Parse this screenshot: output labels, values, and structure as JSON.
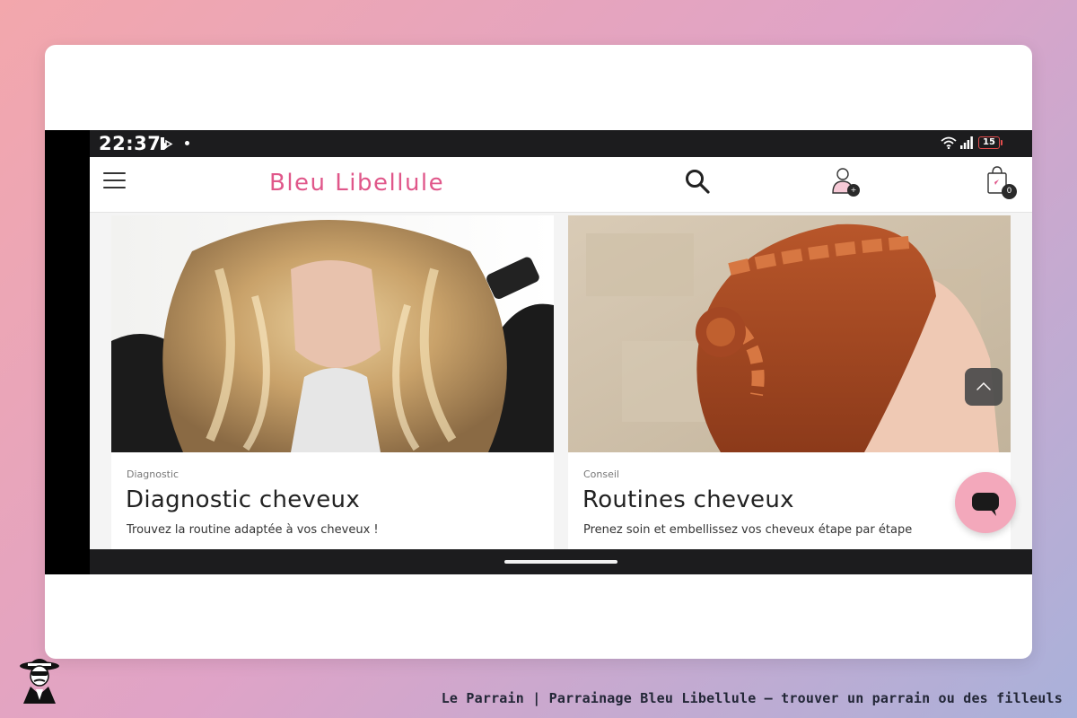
{
  "status_bar": {
    "time": "22:37",
    "battery_level": "15",
    "icons": [
      "app-notification-icon",
      "wifi-icon",
      "signal-icon",
      "battery-icon"
    ]
  },
  "header": {
    "brand": "Bleu Libellule",
    "brand_color": "#e0578a",
    "cart_count": "0",
    "account_badge": "+",
    "icons": [
      "hamburger-menu-icon",
      "search-icon",
      "user-account-icon",
      "shopping-bag-icon"
    ]
  },
  "articles": [
    {
      "category": "Diagnostic",
      "title": "Diagnostic cheveux",
      "description": "Trouvez la routine adaptée à vos cheveux !"
    },
    {
      "category": "Conseil",
      "title": "Routines cheveux",
      "description": "Prenez soin et embellissez vos cheveux étape par étape"
    }
  ],
  "floating": {
    "icons": [
      "chevron-up-icon",
      "chat-icon"
    ],
    "chat_color": "#f3a8bb"
  },
  "footer": {
    "caption": "Le Parrain | Parrainage Bleu Libellule — trouver un parrain ou des filleuls"
  }
}
